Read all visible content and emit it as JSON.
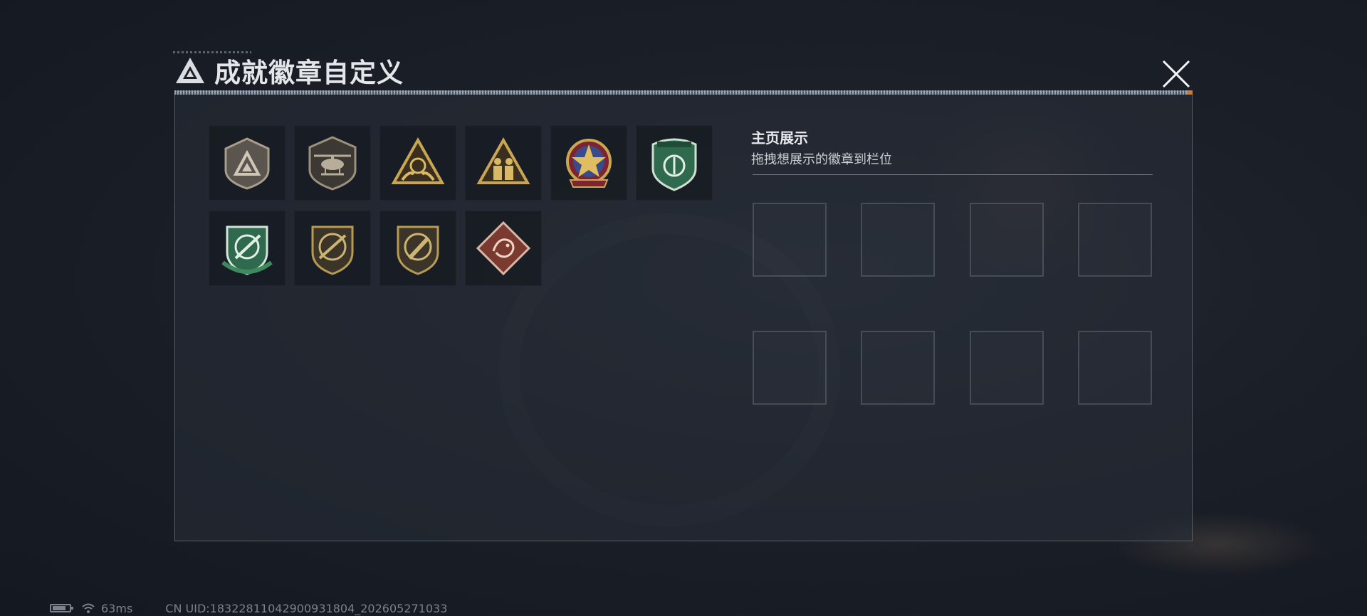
{
  "window": {
    "title": "成就徽章自定义"
  },
  "badges": [
    {
      "icon": "triangle-shield-badge-icon"
    },
    {
      "icon": "helicopter-shield-badge-icon"
    },
    {
      "icon": "gold-triangle-hands-badge-icon"
    },
    {
      "icon": "gold-triangle-soldiers-badge-icon"
    },
    {
      "icon": "star-medallion-badge-icon"
    },
    {
      "icon": "green-shield-badge-icon"
    },
    {
      "icon": "green-crosshair-rifle-badge-icon"
    },
    {
      "icon": "rifle-crosshair-badge-icon"
    },
    {
      "icon": "knife-crosshair-badge-icon"
    },
    {
      "icon": "dragon-diamond-badge-icon"
    }
  ],
  "showcase": {
    "title": "主页展示",
    "subtitle": "拖拽想展示的徽章到栏位",
    "slot_count": 8
  },
  "status": {
    "ping": "63ms",
    "uid": "CN UID:18322811042900931804_202605271033"
  },
  "colors": {
    "gold": "#b89a52",
    "green_badge": "#3d7a5a",
    "accent_orange": "#c77d3a"
  }
}
